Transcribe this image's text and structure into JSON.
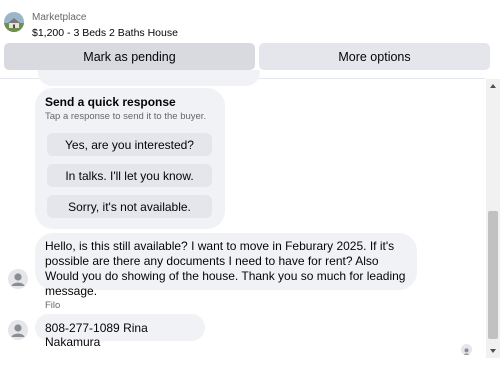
{
  "header": {
    "marketplace_label": "Marketplace",
    "listing_title": "$1,200 - 3 Beds 2 Baths House",
    "mark_pending_label": "Mark as pending",
    "more_options_label": "More options"
  },
  "quick_response": {
    "title": "Send a quick response",
    "subtitle": "Tap a response to send it to the buyer.",
    "options": [
      "Yes, are you interested?",
      "In talks. I'll let you know.",
      "Sorry, it's not available."
    ]
  },
  "messages": [
    {
      "text": "Hello, is this still available? I want to move in Feburary 2025. If it's possible are there any documents I need to have for rent? Also Would you do showing of the house. Thank you so much for leading message."
    },
    {
      "sender": "Filo",
      "text": "808-277-1089 Rina Nakamura"
    }
  ],
  "colors": {
    "bubble": "#f0f2f5",
    "button": "#e4e6eb",
    "secondary_text": "#65676b"
  },
  "icons": {
    "listing_thumbnail": "house-photo-icon",
    "user_avatar": "default-user-icon",
    "seen_indicator": "seen-avatar-icon"
  }
}
